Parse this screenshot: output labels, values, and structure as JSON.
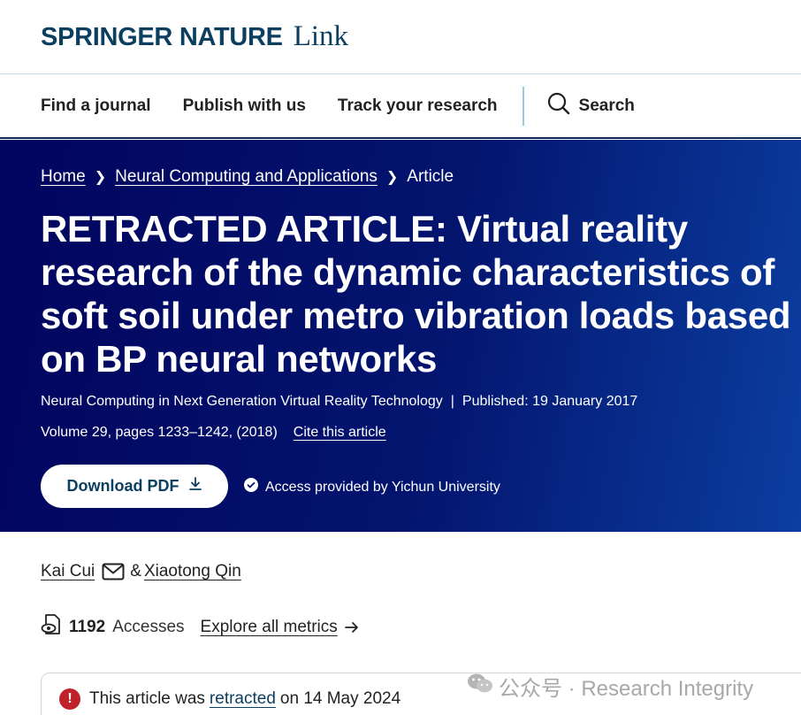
{
  "logo": {
    "brand": "SPRINGER NATURE",
    "product": "Link"
  },
  "nav": {
    "items": [
      "Find a journal",
      "Publish with us",
      "Track your research"
    ],
    "search_label": "Search"
  },
  "breadcrumb": {
    "home": "Home",
    "journal": "Neural Computing and Applications",
    "current": "Article"
  },
  "article": {
    "title": "RETRACTED ARTICLE: Virtual reality research of the dynamic characteristics of soft soil under metro vibration loads based on BP neural networks",
    "collection": "Neural Computing in Next Generation Virtual Reality Technology",
    "separator": "|",
    "published": "Published: 19 January 2017",
    "volume": "Volume 29, pages 1233–1242, (2018)",
    "cite_label": "Cite this article",
    "download_label": "Download PDF",
    "access_text": "Access provided by Yichun University"
  },
  "authors": {
    "first": "Kai Cui",
    "ampersand": "&",
    "second": "Xiaotong Qin"
  },
  "metrics": {
    "count": "1192",
    "label": "Accesses",
    "explore": "Explore all metrics"
  },
  "notice": {
    "prefix": "This article was",
    "link": "retracted",
    "suffix": "on 14 May 2024"
  },
  "watermark": {
    "text": "公众号 · Research Integrity"
  },
  "colors": {
    "brand": "#0b3e5f",
    "hero_dark": "#02045e",
    "hero_light": "#0b3ea0",
    "alert": "#c0222b"
  }
}
